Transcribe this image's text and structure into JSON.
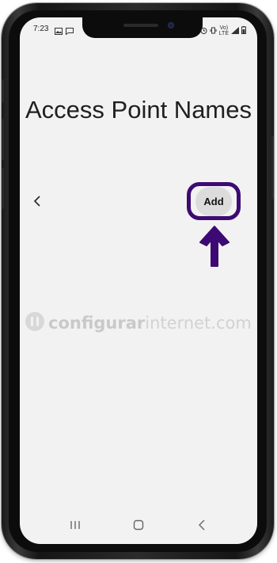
{
  "status_bar": {
    "time": "7:23",
    "net_label_top": "Vo)",
    "net_label_bottom": "LTE"
  },
  "header": {
    "title": "Access Point Names"
  },
  "toolbar": {
    "add_label": "Add"
  },
  "watermark": {
    "bold_part": "configurar",
    "normal_part": "internet.com"
  },
  "colors": {
    "highlight": "#3d0a73",
    "screen_bg": "#f2f2f2",
    "add_button_bg": "#dcdcdc"
  },
  "icons": {
    "back": "chevron-left-icon",
    "arrow": "arrow-up-icon",
    "nav_recents": "recents-icon",
    "nav_home": "home-icon",
    "nav_back": "back-nav-icon"
  }
}
